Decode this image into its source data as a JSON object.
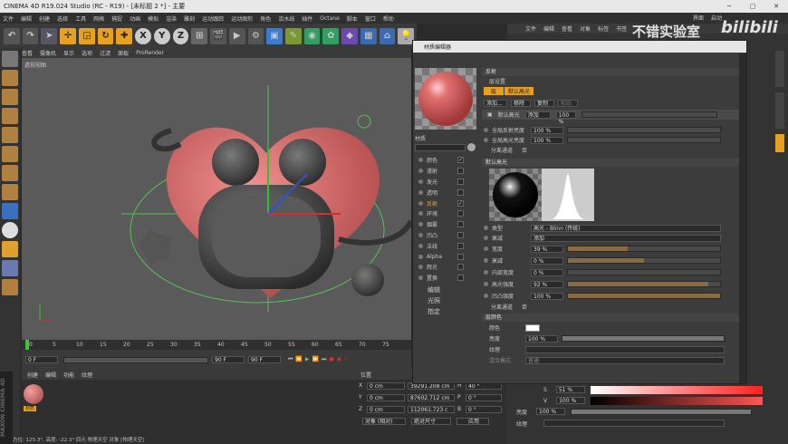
{
  "window": {
    "title": "CINEMA 4D R19.024 Studio (RC - R19) - [未标题 2 *] - 主要"
  },
  "menubar": [
    "文件",
    "编辑",
    "创建",
    "选择",
    "工具",
    "网格",
    "捕捉",
    "动画",
    "模拟",
    "渲染",
    "雕刻",
    "运动跟踪",
    "运动图形",
    "角色",
    "流水线",
    "插件",
    "Octane",
    "脚本",
    "窗口",
    "帮助"
  ],
  "right_menubar": [
    "界面",
    "启动"
  ],
  "watermark": {
    "text": "不错实验室",
    "logo": "bilibili"
  },
  "viewport": {
    "menu": [
      "查看",
      "摄像机",
      "显示",
      "选项",
      "过滤",
      "面板",
      "ProRender"
    ],
    "label": "透视视图"
  },
  "timeline": {
    "ticks": [
      "0",
      "5",
      "10",
      "15",
      "20",
      "25",
      "30",
      "35",
      "40",
      "45",
      "50",
      "55",
      "60",
      "65",
      "70",
      "75"
    ],
    "start": "0 F",
    "end": "90 F",
    "end2": "90 F",
    "current": "0 F"
  },
  "objects": {
    "menu": [
      "创建",
      "编辑",
      "功能",
      "纹理"
    ],
    "material_name": "材质"
  },
  "coords": {
    "header": "位置",
    "rows": [
      {
        "axis": "X",
        "pos": "0 cm",
        "size": "39291.208 cm",
        "rot_label": "H",
        "rot": "40 °"
      },
      {
        "axis": "Y",
        "pos": "0 cm",
        "size": "87602.712 cm",
        "rot_label": "P",
        "rot": "0 °"
      },
      {
        "axis": "Z",
        "pos": "0 cm",
        "size": "112061.723 c",
        "rot_label": "B",
        "rot": "0 °"
      }
    ],
    "btn1": "对象 (相对)",
    "btn2": "绝对尺寸",
    "apply": "应用"
  },
  "statusbar": "方位: 125.3°, 高度: -22.3° 四元   物理天空 对象 [物理天空]",
  "matwin": {
    "title": "材质编辑器",
    "mat_name": "材质",
    "channels": [
      {
        "name": "颜色",
        "checked": true
      },
      {
        "name": "漫射",
        "checked": false
      },
      {
        "name": "发光",
        "checked": false
      },
      {
        "name": "透明",
        "checked": false
      },
      {
        "name": "反射",
        "checked": true,
        "active": true
      },
      {
        "name": "环境",
        "checked": false
      },
      {
        "name": "烟雾",
        "checked": false
      },
      {
        "name": "凹凸",
        "checked": false
      },
      {
        "name": "法线",
        "checked": false
      },
      {
        "name": "Alpha",
        "checked": false
      },
      {
        "name": "辉光",
        "checked": false
      },
      {
        "name": "置换",
        "checked": false
      }
    ],
    "extra": [
      "编辑",
      "光照",
      "指定"
    ],
    "reflect": {
      "header": "反射",
      "layer_settings": "层设置",
      "tabs": [
        "层",
        "默认高光"
      ],
      "buttons": [
        "添加...",
        "移除",
        "复制",
        "粘贴"
      ],
      "layer_name": "默认高光",
      "layer_mode": "添加",
      "layer_pct": "100 %",
      "global_refl_label": "全局反射亮度",
      "global_refl": "100 %",
      "global_spec_label": "全局高光亮度",
      "global_spec": "100 %",
      "sep_pass_label": "分离通道",
      "sep_pass": "否"
    },
    "default_spec": {
      "header": "默认高光",
      "type_label": "类型",
      "type": "高光 - Blinn (传统)",
      "atten_label": "衰减",
      "atten": "添加",
      "params": [
        {
          "label": "宽度",
          "value": "39 %",
          "fill": 0.39
        },
        {
          "label": "衰减",
          "value": "0 %",
          "fill": 0.5
        },
        {
          "label": "内部宽度",
          "value": "0 %",
          "fill": 0.0
        },
        {
          "label": "高光强度",
          "value": "92 %",
          "fill": 0.92
        },
        {
          "label": "凹凸强度",
          "value": "100 %",
          "fill": 1.0
        }
      ],
      "sep_pass_label": "分离通道",
      "sep_pass": "否"
    },
    "layer_color": {
      "header": "层颜色",
      "color_label": "颜色",
      "bright_label": "亮度",
      "bright": "100 %",
      "tex_label": "纹理",
      "mix_label": "混合模式",
      "mix": "普通"
    }
  },
  "rightpanel": {
    "menu": [
      "文件",
      "编辑",
      "查看",
      "对象",
      "标签",
      "书签"
    ],
    "s_label": "S",
    "s_val": "51 %",
    "v_label": "V",
    "v_val": "100 %",
    "bright_label": "亮度",
    "bright": "100 %",
    "tex_label": "纹理"
  },
  "colors": {
    "accent": "#f0a020",
    "heart": "#e06a6a",
    "viewport": "#5a5a5a"
  }
}
